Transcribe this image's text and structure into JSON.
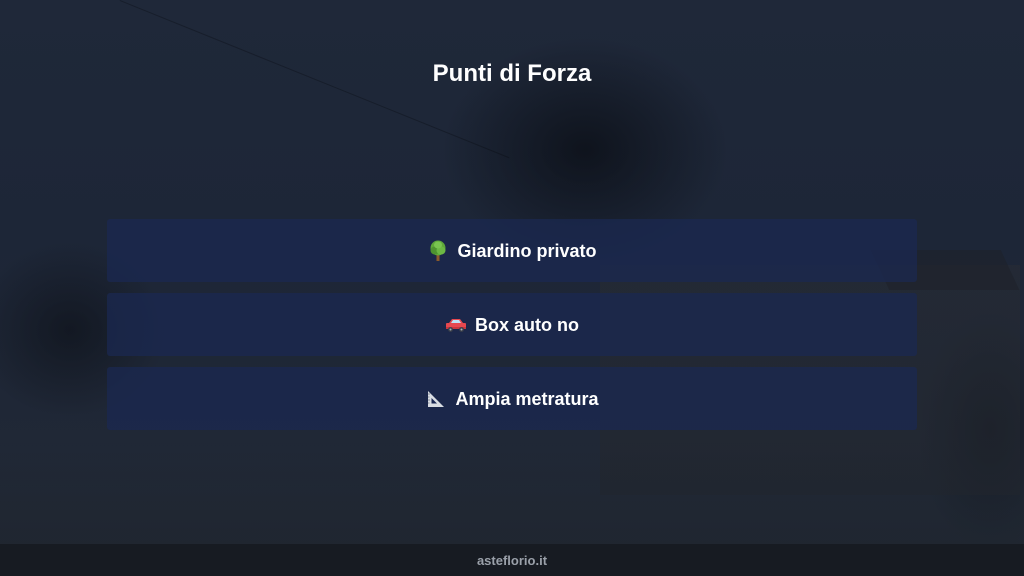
{
  "title": "Punti di Forza",
  "features": [
    {
      "icon": "tree-icon",
      "label": "Giardino privato"
    },
    {
      "icon": "car-icon",
      "label": "Box auto no"
    },
    {
      "icon": "triangular-ruler-icon",
      "label": "Ampia metratura"
    }
  ],
  "footer": {
    "text": "asteflorio.it"
  },
  "colors": {
    "card_background": "#1a2852",
    "footer_background": "#171b22",
    "title_text": "#ffffff",
    "footer_text": "#9aa0a9"
  }
}
